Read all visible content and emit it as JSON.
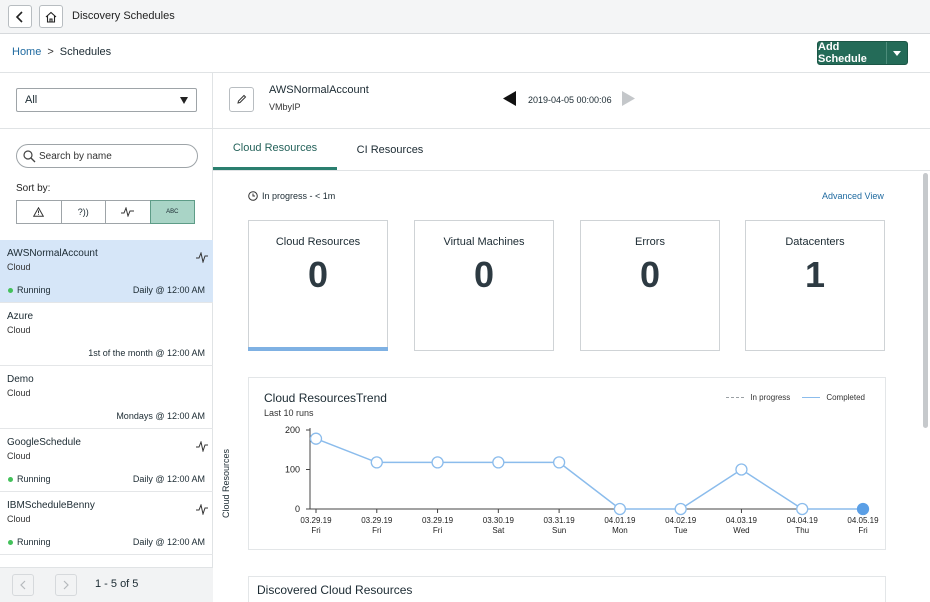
{
  "topbar": {
    "title": "Discovery Schedules"
  },
  "breadcrumb": {
    "home": "Home",
    "separator": ">",
    "current": "Schedules"
  },
  "add_button": {
    "label": "Add Schedule"
  },
  "filter": {
    "selected": "All"
  },
  "search": {
    "placeholder": "Search by name"
  },
  "sort": {
    "label": "Sort by:",
    "options": [
      "⚠",
      "?))",
      "pulse",
      "ABC"
    ],
    "active": "ABC"
  },
  "schedules": [
    {
      "name": "AWSNormalAccount",
      "type": "Cloud",
      "status": "Running",
      "schedule": "Daily @ 12:00 AM",
      "activity": true,
      "selected": true
    },
    {
      "name": "Azure",
      "type": "Cloud",
      "status": "",
      "schedule": "1st of the month @ 12:00 AM",
      "activity": false,
      "selected": false
    },
    {
      "name": "Demo",
      "type": "Cloud",
      "status": "",
      "schedule": "Mondays @ 12:00 AM",
      "activity": false,
      "selected": false
    },
    {
      "name": "GoogleSchedule",
      "type": "Cloud",
      "status": "Running",
      "schedule": "Daily @ 12:00 AM",
      "activity": true,
      "selected": false
    },
    {
      "name": "IBMScheduleBenny",
      "type": "Cloud",
      "status": "Running",
      "schedule": "Daily @ 12:00 AM",
      "activity": true,
      "selected": false
    }
  ],
  "pager": {
    "text": "1 - 5 of 5"
  },
  "detail": {
    "name": "AWSNormalAccount",
    "sub": "VMbyIP",
    "date": "2019-04-05 00:00:06"
  },
  "tabs": [
    {
      "label": "Cloud Resources",
      "active": true
    },
    {
      "label": "CI Resources",
      "active": false
    }
  ],
  "progress": {
    "text": "In progress - < 1m"
  },
  "advanced_view": "Advanced View",
  "cards": [
    {
      "title": "Cloud Resources",
      "value": "0",
      "active": true
    },
    {
      "title": "Virtual Machines",
      "value": "0",
      "active": false
    },
    {
      "title": "Errors",
      "value": "0",
      "active": false
    },
    {
      "title": "Datacenters",
      "value": "1",
      "active": false
    }
  ],
  "trend": {
    "title": "Cloud ResourcesTrend",
    "subtitle": "Last 10 runs",
    "legend_in_progress": "In progress",
    "legend_completed": "Completed"
  },
  "chart_data": {
    "type": "line",
    "title": "Cloud ResourcesTrend",
    "ylabel": "Cloud Resources",
    "ylim": [
      0,
      200
    ],
    "yticks": [
      0,
      100,
      200
    ],
    "categories": [
      "03.29.19",
      "03.29.19",
      "03.29.19",
      "03.30.19",
      "03.31.19",
      "04.01.19",
      "04.02.19",
      "04.03.19",
      "04.04.19",
      "04.05.19"
    ],
    "days": [
      "Fri",
      "Fri",
      "Fri",
      "Sat",
      "Sun",
      "Mon",
      "Tue",
      "Wed",
      "Thu",
      "Fri"
    ],
    "series": [
      {
        "name": "Completed",
        "values": [
          178,
          118,
          118,
          118,
          118,
          0,
          0,
          100,
          0,
          0
        ]
      }
    ],
    "last_point_in_progress": true,
    "colors": {
      "line": "#8bbcec",
      "marker_fill": "#ffffff",
      "active_marker": "#5b9fe6"
    }
  },
  "discovered": {
    "title": "Discovered Cloud Resources"
  },
  "colors": {
    "accent": "#246b58",
    "selected_row": "#d6e6f8",
    "link": "#1f6aa0",
    "running": "#43c15a"
  }
}
